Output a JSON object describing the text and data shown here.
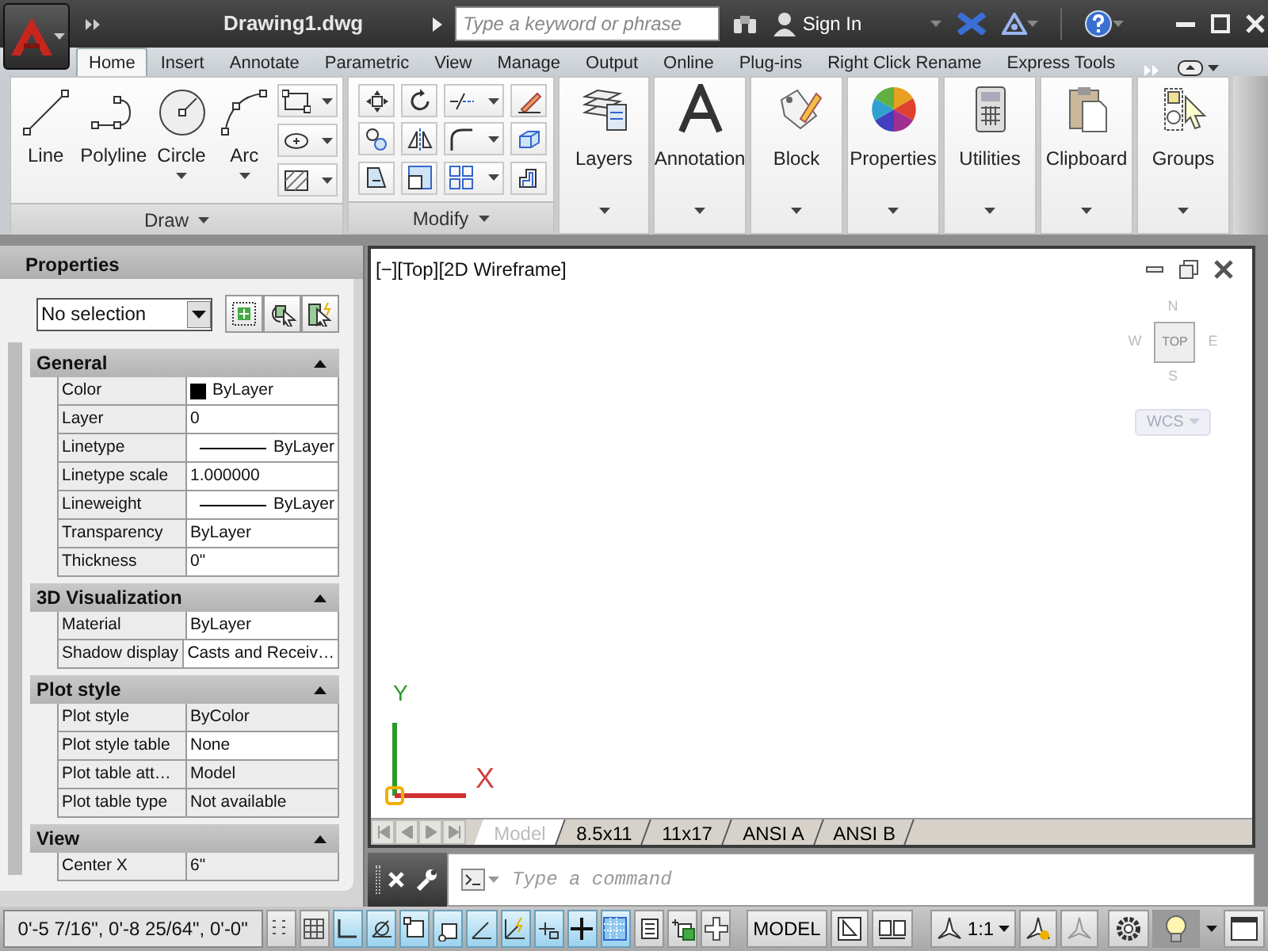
{
  "title_bar": {
    "title": "Drawing1.dwg",
    "search": {
      "placeholder": "Type a keyword or phrase"
    },
    "sign_in": "Sign In"
  },
  "ribbon_tabs": [
    {
      "label": "Home",
      "selected": true
    },
    {
      "label": "Insert",
      "selected": false
    },
    {
      "label": "Annotate",
      "selected": false
    },
    {
      "label": "Parametric",
      "selected": false
    },
    {
      "label": "View",
      "selected": false
    },
    {
      "label": "Manage",
      "selected": false
    },
    {
      "label": "Output",
      "selected": false
    },
    {
      "label": "Online",
      "selected": false
    },
    {
      "label": "Plug-ins",
      "selected": false
    },
    {
      "label": "Right Click Rename",
      "selected": false
    },
    {
      "label": "Express Tools",
      "selected": false
    }
  ],
  "draw_panel": {
    "title": "Draw",
    "tools": [
      {
        "label": "Line",
        "has_menu": false
      },
      {
        "label": "Polyline",
        "has_menu": false
      },
      {
        "label": "Circle",
        "has_menu": true
      },
      {
        "label": "Arc",
        "has_menu": true
      }
    ]
  },
  "modify_panel": {
    "title": "Modify"
  },
  "panel_buttons": [
    {
      "label": "Layers"
    },
    {
      "label": "Annotation"
    },
    {
      "label": "Block"
    },
    {
      "label": "Properties"
    },
    {
      "label": "Utilities"
    },
    {
      "label": "Clipboard"
    },
    {
      "label": "Groups"
    }
  ],
  "properties_palette": {
    "title": "Properties",
    "selection": "No selection",
    "sections": [
      {
        "title": "General",
        "expanded": true,
        "rows": [
          {
            "name": "Color",
            "value": "ByLayer",
            "kind": "color",
            "disabled": false
          },
          {
            "name": "Layer",
            "value": "0",
            "kind": "text",
            "disabled": false
          },
          {
            "name": "Linetype",
            "value": "ByLayer",
            "kind": "line",
            "disabled": false
          },
          {
            "name": "Linetype scale",
            "value": "1.000000",
            "kind": "text",
            "disabled": false
          },
          {
            "name": "Lineweight",
            "value": "ByLayer",
            "kind": "line",
            "disabled": false
          },
          {
            "name": "Transparency",
            "value": "ByLayer",
            "kind": "text",
            "disabled": false
          },
          {
            "name": "Thickness",
            "value": "0\"",
            "kind": "text",
            "disabled": false
          }
        ]
      },
      {
        "title": "3D Visualization",
        "expanded": true,
        "rows": [
          {
            "name": "Material",
            "value": "ByLayer",
            "kind": "text",
            "disabled": false
          },
          {
            "name": "Shadow display",
            "value": "Casts and Receiv…",
            "kind": "text",
            "disabled": false
          }
        ]
      },
      {
        "title": "Plot style",
        "expanded": true,
        "rows": [
          {
            "name": "Plot style",
            "value": "ByColor",
            "kind": "text",
            "disabled": true
          },
          {
            "name": "Plot style table",
            "value": "None",
            "kind": "text",
            "disabled": false
          },
          {
            "name": "Plot table att…",
            "value": "Model",
            "kind": "text",
            "disabled": true
          },
          {
            "name": "Plot table type",
            "value": "Not available",
            "kind": "text",
            "disabled": true
          }
        ]
      },
      {
        "title": "View",
        "expanded": true,
        "rows": [
          {
            "name": "Center X",
            "value": "6\"",
            "kind": "text",
            "disabled": true
          }
        ]
      }
    ]
  },
  "viewport": {
    "label": "[−][Top][2D Wireframe]",
    "viewcube": {
      "north": "N",
      "west": "W",
      "face": "TOP",
      "east": "E",
      "south": "S"
    },
    "wcs": "WCS",
    "ucs": {
      "y": "Y",
      "x": "X"
    }
  },
  "layout_tabs": [
    {
      "label": "Model",
      "selected": true
    },
    {
      "label": "8.5x11",
      "selected": false
    },
    {
      "label": "11x17",
      "selected": false
    },
    {
      "label": "ANSI A",
      "selected": false
    },
    {
      "label": "ANSI B",
      "selected": false
    }
  ],
  "command_line": {
    "placeholder": "Type a command"
  },
  "status_bar": {
    "coordinates": "0'-5 7/16\",  0'-8 25/64\", 0'-0\"",
    "toggles": [
      {
        "on": false
      },
      {
        "on": false
      },
      {
        "on": true
      },
      {
        "on": true
      },
      {
        "on": true
      },
      {
        "on": true
      },
      {
        "on": true
      },
      {
        "on": true
      },
      {
        "on": true
      },
      {
        "on": true
      },
      {
        "on": true
      },
      {
        "on": false
      },
      {
        "on": false
      },
      {
        "on": false
      }
    ],
    "space": "MODEL",
    "scale": "1:1"
  }
}
